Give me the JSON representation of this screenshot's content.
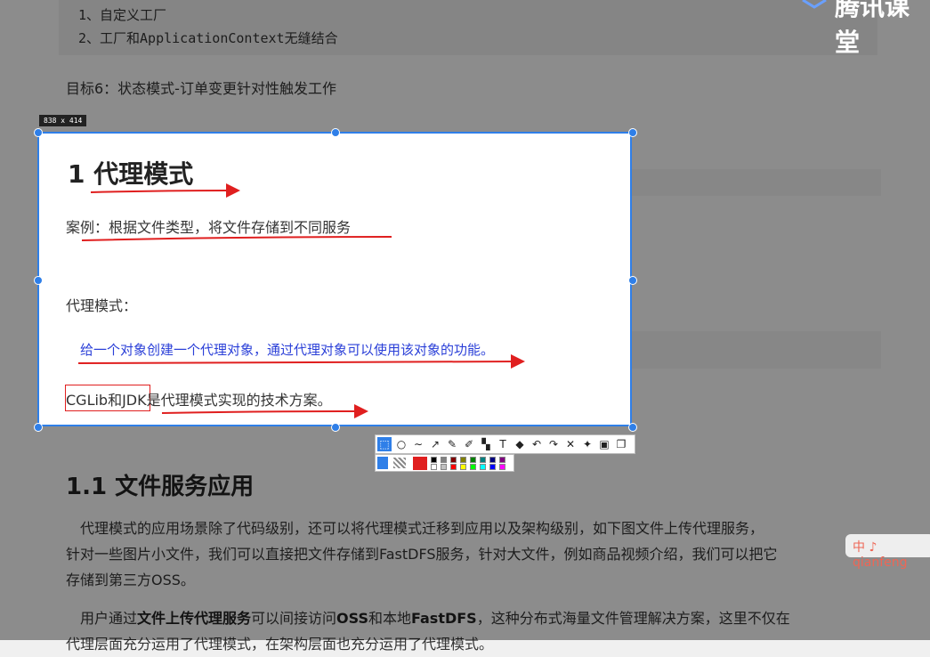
{
  "document": {
    "code_lines": [
      "1、自定义工厂",
      "2、工厂和ApplicationContext无缝结合"
    ],
    "goal": "目标6：状态模式-订单变更针对性触发工作",
    "section_heading": "1.1 文件服务应用",
    "para1_line1": "代理模式的应用场景除了代码级别，还可以将代理模式迁移到应用以及架构级别，如下图文件上传代理服务，",
    "para1_line2": "针对一些图片小文件，我们可以直接把文件存储到FastDFS服务，针对大文件，例如商品视频介绍，我们可以把它",
    "para1_line3": "存储到第三方OSS。",
    "para2_prefix": "用户通过",
    "para2_bold1": "文件上传代理服务",
    "para2_mid1": "可以间接访问",
    "para2_bold2": "OSS",
    "para2_mid2": "和本地",
    "para2_bold3": "FastDFS",
    "para2_suffix": "，这种分布式海量文件管理解决方案，这里不仅在",
    "para3_partial": "代理层面充分运用了代理模式，在架构层面也充分运用了代理模式。"
  },
  "brand": {
    "text": "腾讯课堂"
  },
  "side_badge": {
    "text": "中 ♪ qianfeng"
  },
  "capture": {
    "size_label": "838 x 414",
    "title": "1 代理模式",
    "case_text": "案例：根据文件类型，将文件存储到不同服务",
    "proxy_label": "代理模式：",
    "description": "给一个对象创建一个代理对象，通过代理对象可以使用该对象的功能。",
    "tech_text": "CGLib和JDK是代理模式实现的技术方案。"
  },
  "toolbar": {
    "tools": [
      {
        "name": "select-tool-icon",
        "glyph": "⬚"
      },
      {
        "name": "ellipse-tool-icon",
        "glyph": "○"
      },
      {
        "name": "curve-tool-icon",
        "glyph": "∼"
      },
      {
        "name": "arrow-tool-icon",
        "glyph": "↗"
      },
      {
        "name": "pen-tool-icon",
        "glyph": "✎"
      },
      {
        "name": "marker-tool-icon",
        "glyph": "✐"
      },
      {
        "name": "mosaic-tool-icon",
        "glyph": "▚"
      },
      {
        "name": "text-tool-icon",
        "glyph": "T"
      },
      {
        "name": "eraser-tool-icon",
        "glyph": "◆"
      },
      {
        "name": "undo-icon",
        "glyph": "↶"
      },
      {
        "name": "redo-icon",
        "glyph": "↷"
      },
      {
        "name": "close-icon",
        "glyph": "✕"
      },
      {
        "name": "pin-icon",
        "glyph": "✦"
      },
      {
        "name": "save-icon",
        "glyph": "▣"
      },
      {
        "name": "copy-icon",
        "glyph": "❐"
      }
    ],
    "current_color": "#e01f1f",
    "palette": [
      "#000000",
      "#808080",
      "#800000",
      "#808000",
      "#008000",
      "#008080",
      "#000080",
      "#800080",
      "#ffffff",
      "#c0c0c0",
      "#ff0000",
      "#ffff00",
      "#00ff00",
      "#00ffff",
      "#0000ff",
      "#ff00ff"
    ]
  },
  "colors": {
    "accent": "#2f7fe8",
    "annotation_red": "#e01f1f",
    "description_blue": "#2a3fd8"
  }
}
